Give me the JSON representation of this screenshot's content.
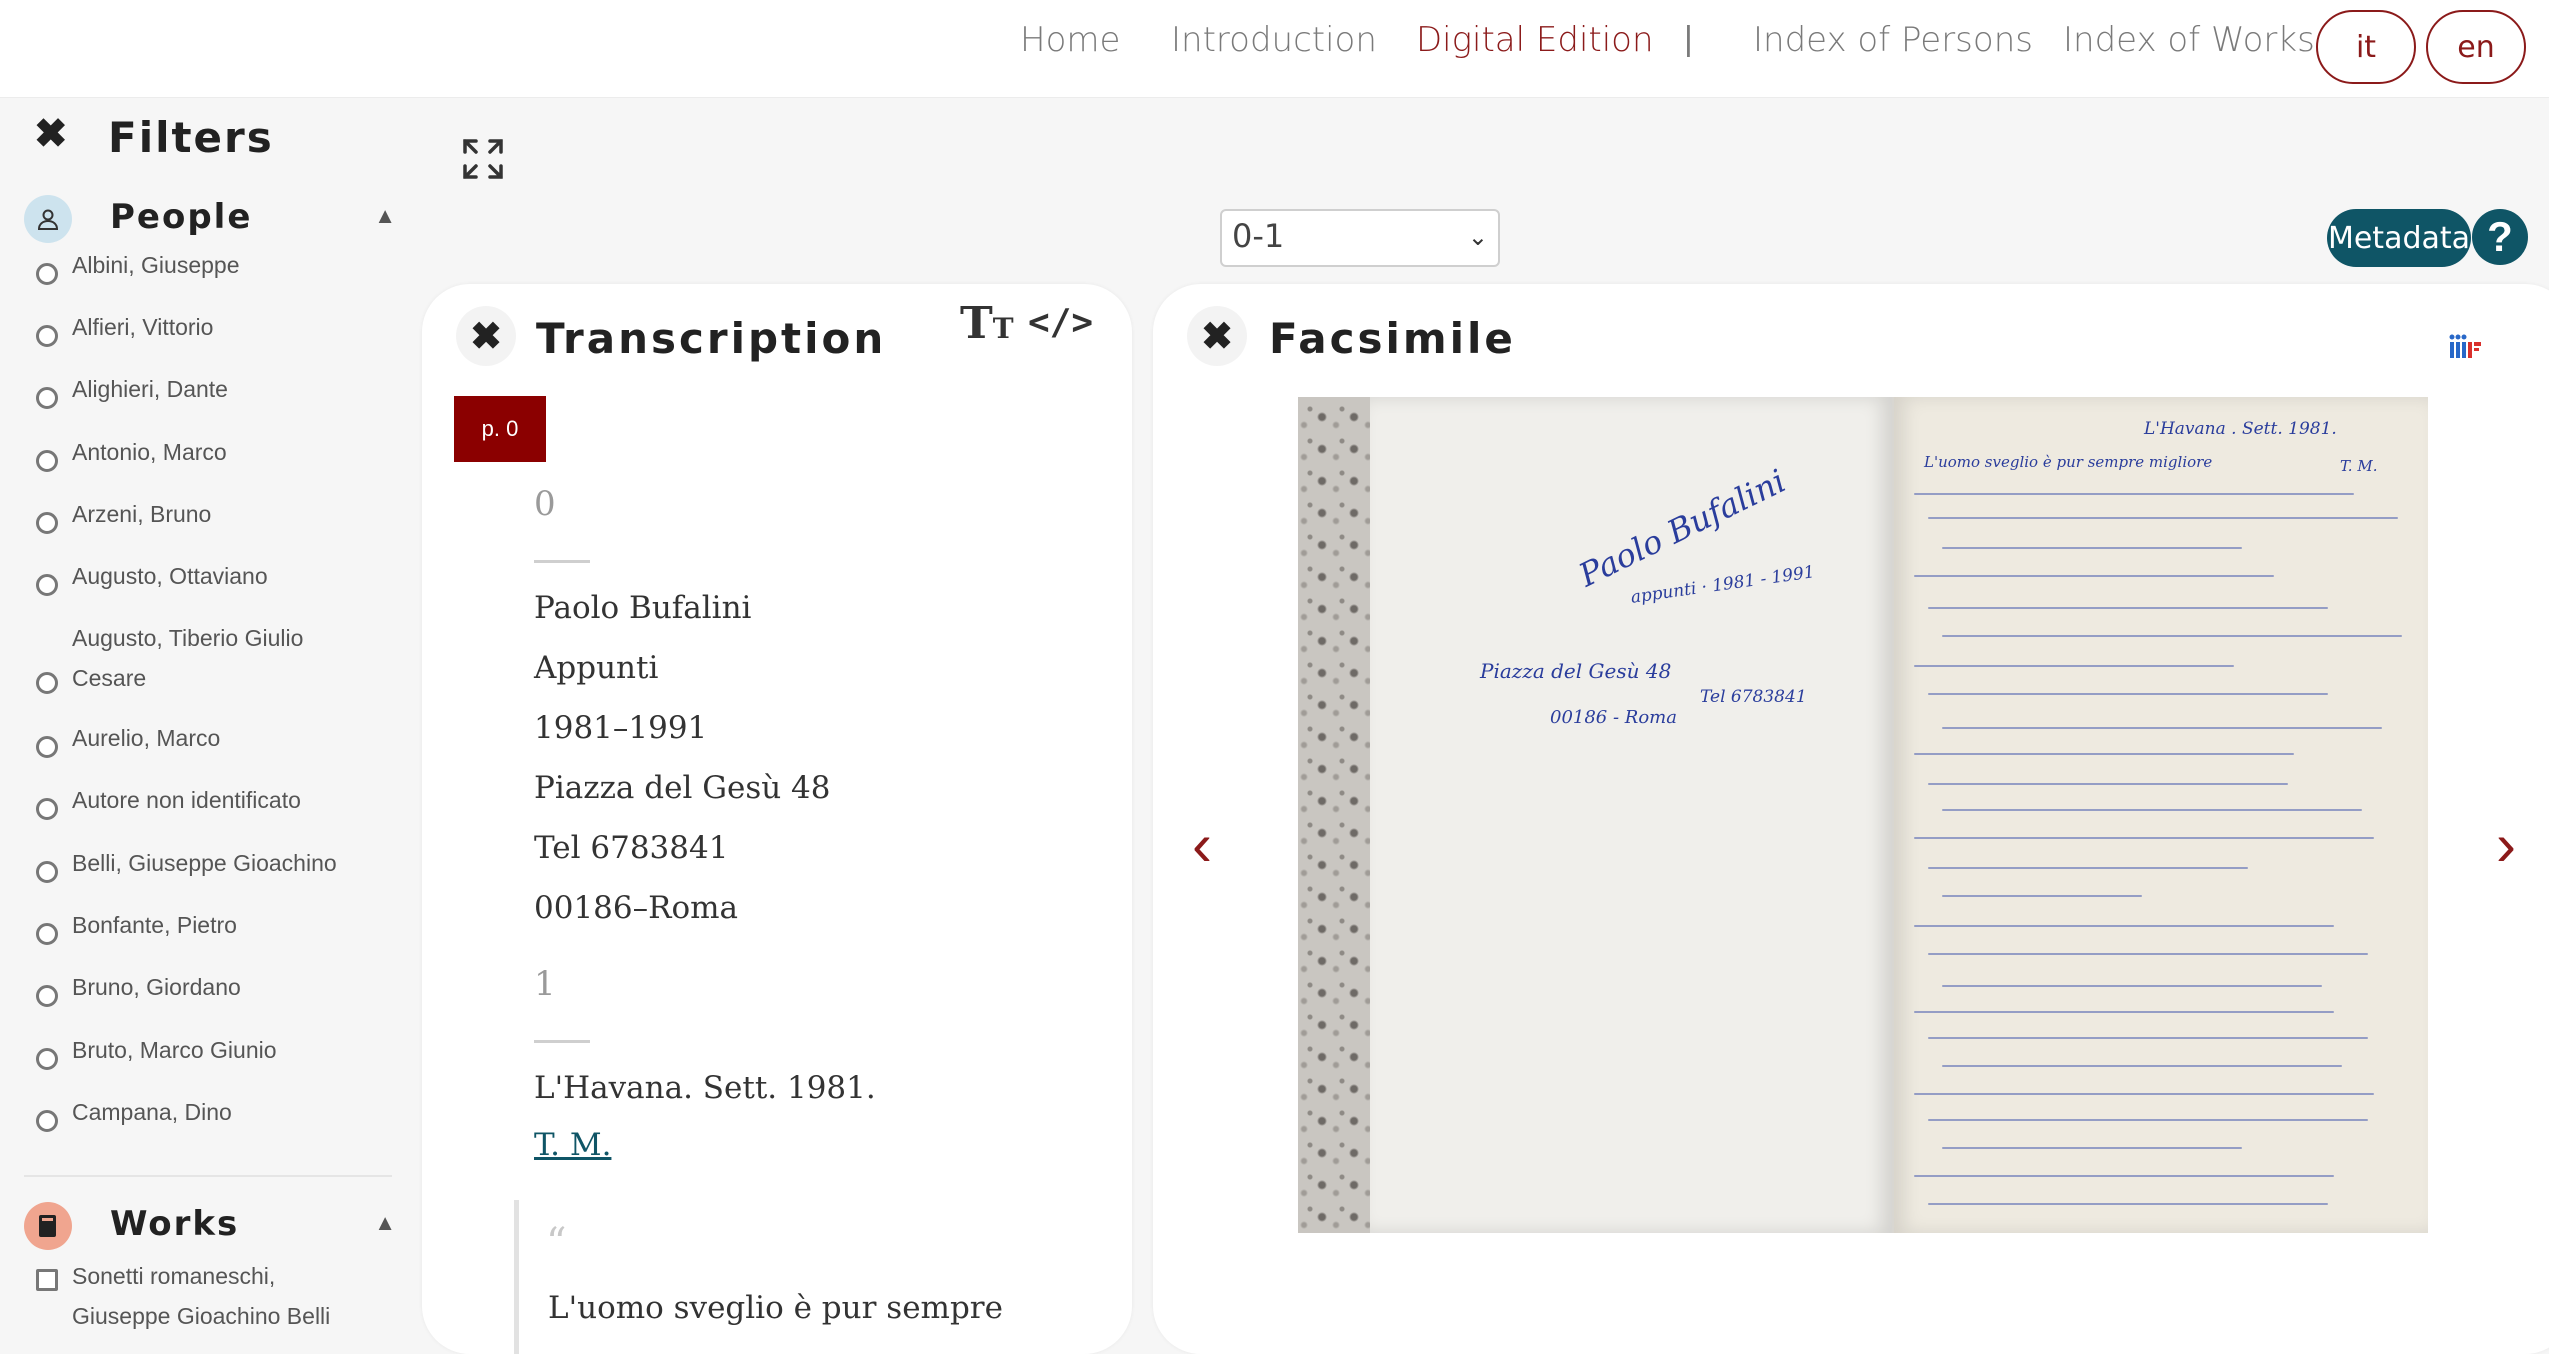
{
  "nav": {
    "links": [
      "Home",
      "Introduction",
      "Digital Edition",
      "Index of Persons",
      "Index of Works"
    ],
    "separator": "|",
    "languages": [
      "it",
      "en"
    ],
    "active_link": "Digital Edition",
    "accent_color": "#8b1a1a"
  },
  "filters": {
    "close_icon": "close-icon",
    "title": "Filters",
    "people": {
      "title": "People",
      "icon": "person-icon",
      "items": [
        "Albini, Giuseppe",
        "Alfieri, Vittorio",
        "Alighieri, Dante",
        "Antonio, Marco",
        "Arzeni, Bruno",
        "Augusto, Ottaviano",
        "Augusto, Tiberio Giulio Cesare",
        "Aurelio, Marco",
        "Autore non identificato",
        "Belli, Giuseppe Gioachino",
        "Bonfante, Pietro",
        "Bruno, Giordano",
        "Bruto, Marco Giunio",
        "Campana, Dino"
      ]
    },
    "works": {
      "title": "Works",
      "icon": "book-icon",
      "items": [
        "Sonetti romaneschi, Giuseppe Gioachino Belli"
      ]
    }
  },
  "toolbar": {
    "page_select_value": "0-1",
    "metadata_label": "Metadata",
    "help_label": "?"
  },
  "transcription": {
    "title": "Transcription",
    "page_badge": "p. 0",
    "page0_number": "0",
    "page0_lines": [
      "Paolo Bufalini",
      "Appunti",
      "1981–1991",
      "Piazza del Gesù 48",
      "Tel 6783841",
      "00186–Roma"
    ],
    "page1_number": "1",
    "page1_heading": "L'Havana. Sett. 1981.",
    "page1_link": "T. M.",
    "quote_mark": "“",
    "quote_text": "L'uomo sveglio è pur sempre"
  },
  "facsimile": {
    "title": "Facsimile",
    "prev_icon": "chevron-left-icon",
    "next_icon": "chevron-right-icon",
    "left_page_text": {
      "name": "Paolo Bufalini",
      "notes": "appunti · 1981 - 1991",
      "address": "Piazza del Gesù 48",
      "city": "00186 - Roma",
      "phone": "Tel 6783841"
    },
    "right_page_header": "L'Havana . Sett. 1981.",
    "right_page_line1": "L'uomo sveglio è pur sempre migliore",
    "right_page_initials": "T. M."
  }
}
